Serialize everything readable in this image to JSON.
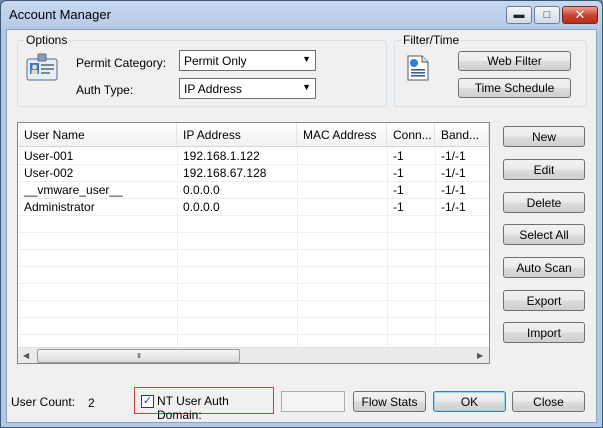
{
  "window": {
    "title": "Account Manager",
    "controls": {
      "minimize": "▬",
      "maximize": "□",
      "close": "✕"
    }
  },
  "options": {
    "group_label": "Options",
    "icon": "id-card-icon",
    "permit_category_label": "Permit Category:",
    "permit_category_value": "Permit Only",
    "auth_type_label": "Auth Type:",
    "auth_type_value": "IP Address"
  },
  "filter_time": {
    "group_label": "Filter/Time",
    "icon": "document-icon",
    "web_filter_label": "Web Filter",
    "time_schedule_label": "Time Schedule"
  },
  "table": {
    "columns": [
      "User Name",
      "IP Address",
      "MAC Address",
      "Conn...",
      "Band..."
    ],
    "rows": [
      [
        "User-001",
        "192.168.1.122",
        "",
        "-1",
        "-1/-1"
      ],
      [
        "User-002",
        "192.168.67.128",
        "",
        "-1",
        "-1/-1"
      ],
      [
        "__vmware_user__",
        "0.0.0.0",
        "",
        "-1",
        "-1/-1"
      ],
      [
        "Administrator",
        "0.0.0.0",
        "",
        "-1",
        "-1/-1"
      ]
    ],
    "scroll_grip": "III"
  },
  "side_buttons": {
    "new": "New",
    "edit": "Edit",
    "delete": "Delete",
    "select_all": "Select All",
    "auto_scan": "Auto Scan",
    "export": "Export",
    "import": "Import"
  },
  "footer": {
    "user_count_label": "User Count:",
    "user_count_value": "2",
    "nt_domain_label": "NT User Auth Domain:",
    "nt_domain_checked": true,
    "nt_domain_value": "",
    "flow_stats_label": "Flow Stats",
    "ok_label": "OK",
    "close_label": "Close"
  },
  "colors": {
    "title_bar": "#b9cde8",
    "close_button": "#c8402c",
    "highlight_border": "#d33a3a"
  }
}
